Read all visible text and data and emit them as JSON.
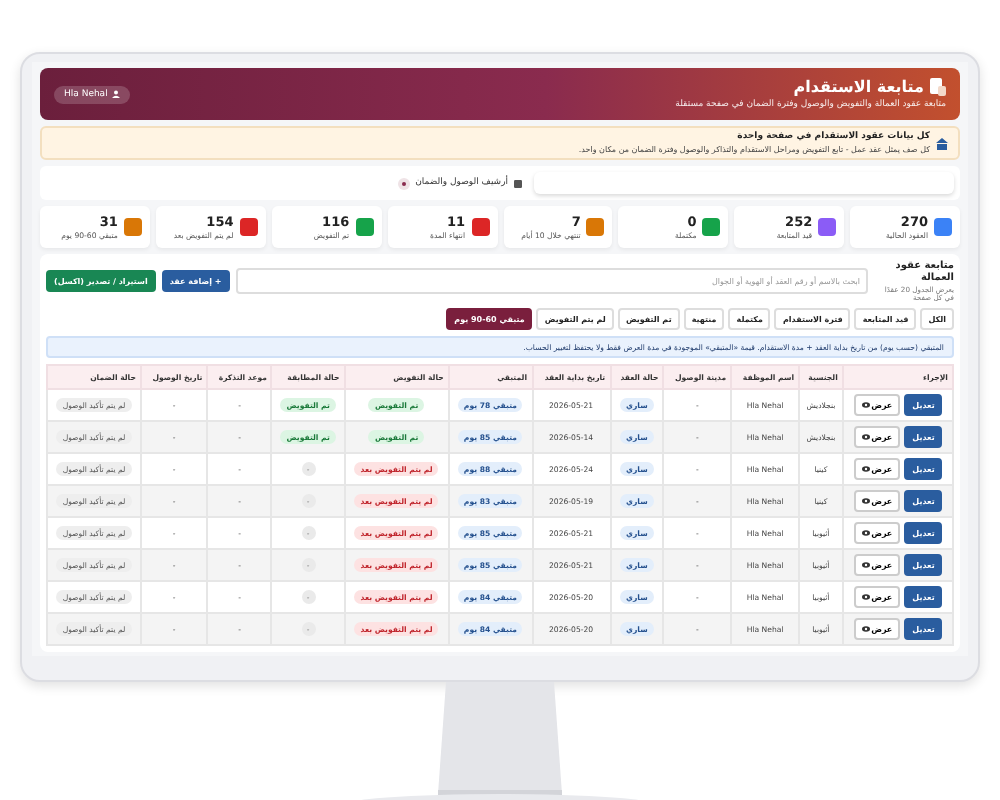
{
  "header": {
    "title": "متابعة الاستقدام",
    "subtitle": "متابعة عقود العمالة والتفويض والوصول وفترة الضمان في صفحة مستقلة",
    "user": "Hla Nehal"
  },
  "notice": {
    "title": "كل بيانات عقود الاستقدام في صفحة واحدة",
    "text": "كل صف يمثل عقد عمل - تابع التفويض ومراحل الاستقدام والتذاكر والوصول وفترة الضمان من مكان واحد."
  },
  "archive": {
    "label": "أرشيف الوصول والضمان"
  },
  "stats": [
    {
      "value": "270",
      "label": "العقود الحالية",
      "color": "#3b82f6"
    },
    {
      "value": "252",
      "label": "قيد المتابعة",
      "color": "#8b5cf6"
    },
    {
      "value": "0",
      "label": "مكتملة",
      "color": "#16a34a"
    },
    {
      "value": "7",
      "label": "تنتهي خلال 10 أيام",
      "color": "#d97706"
    },
    {
      "value": "11",
      "label": "انتهاء المدة",
      "color": "#dc2626"
    },
    {
      "value": "116",
      "label": "تم التفويض",
      "color": "#16a34a"
    },
    {
      "value": "154",
      "label": "لم يتم التفويض بعد",
      "color": "#dc2626"
    },
    {
      "value": "31",
      "label": "متبقي 60-90 يوم",
      "color": "#d97706"
    }
  ],
  "table_card": {
    "title": "متابعة عقود العمالة",
    "subtitle": "يعرض الجدول 20 عقدًا في كل صفحة",
    "search": {
      "placeholder": "ابحث بالاسم أو رقم العقد أو الهوية أو الجوال"
    },
    "buttons": [
      {
        "label": "+ إضافة عقد",
        "kind": "primary"
      },
      {
        "label": "استيراد / تصدير (اكسل)",
        "kind": "success"
      }
    ],
    "filters": [
      {
        "label": "الكل",
        "selected": false
      },
      {
        "label": "قيد المتابعة",
        "selected": false
      },
      {
        "label": "فترة الاستقدام",
        "selected": false
      },
      {
        "label": "مكتملة",
        "selected": false
      },
      {
        "label": "منتهية",
        "selected": false
      },
      {
        "label": "تم التفويض",
        "selected": false
      },
      {
        "label": "لم يتم التفويض",
        "selected": false
      },
      {
        "label": "متبقي 60-90 يوم",
        "selected": true
      }
    ],
    "note": "المتبقي (حسب يوم) من تاريخ بداية العقد + مدة الاستقدام. قيمة «المتبقي» الموجودة في مدة العرض فقط ولا يحتفظ لتغيير الحساب.",
    "columns": [
      "الإجراء",
      "الجنسية",
      "اسم الموظفة",
      "مدينة الوصول",
      "حالة العقد",
      "تاريخ بداية العقد",
      "المتبقي",
      "حالة التفويض",
      "حالة المطابقة",
      "موعد التذكرة",
      "تاريخ الوصول",
      "حالة الضمان"
    ],
    "rows": [
      {
        "view": "عرض",
        "edit": "تعديل",
        "nationality": "بنجلاديش",
        "name": "Hla Nehal",
        "city": "-",
        "contract": "ساري",
        "start": "2026-05-21",
        "remaining": "متبقي 78 يوم",
        "auth": {
          "label": "تم التفويض",
          "kind": "done"
        },
        "match": {
          "label": "تم التفويض",
          "kind": "done"
        },
        "ticket": "-",
        "arrival": "-",
        "guarantee": "لم يتم تأكيد الوصول"
      },
      {
        "view": "عرض",
        "edit": "تعديل",
        "nationality": "بنجلاديش",
        "name": "Hla Nehal",
        "city": "-",
        "contract": "ساري",
        "start": "2026-05-14",
        "remaining": "متبقي 85 يوم",
        "auth": {
          "label": "تم التفويض",
          "kind": "done"
        },
        "match": {
          "label": "تم التفويض",
          "kind": "done"
        },
        "ticket": "-",
        "arrival": "-",
        "guarantee": "لم يتم تأكيد الوصول"
      },
      {
        "view": "عرض",
        "edit": "تعديل",
        "nationality": "كينيا",
        "name": "Hla Nehal",
        "city": "-",
        "contract": "ساري",
        "start": "2026-05-24",
        "remaining": "متبقي 88 يوم",
        "auth": {
          "label": "لم يتم التفويض بعد",
          "kind": "pending"
        },
        "match": {
          "label": "-",
          "kind": "none"
        },
        "ticket": "-",
        "arrival": "-",
        "guarantee": "لم يتم تأكيد الوصول"
      },
      {
        "view": "عرض",
        "edit": "تعديل",
        "nationality": "كينيا",
        "name": "Hla Nehal",
        "city": "-",
        "contract": "ساري",
        "start": "2026-05-19",
        "remaining": "متبقي 83 يوم",
        "auth": {
          "label": "لم يتم التفويض بعد",
          "kind": "pending"
        },
        "match": {
          "label": "-",
          "kind": "none"
        },
        "ticket": "-",
        "arrival": "-",
        "guarantee": "لم يتم تأكيد الوصول"
      },
      {
        "view": "عرض",
        "edit": "تعديل",
        "nationality": "أثيوبيا",
        "name": "Hla Nehal",
        "city": "-",
        "contract": "ساري",
        "start": "2026-05-21",
        "remaining": "متبقي 85 يوم",
        "auth": {
          "label": "لم يتم التفويض بعد",
          "kind": "pending"
        },
        "match": {
          "label": "-",
          "kind": "none"
        },
        "ticket": "-",
        "arrival": "-",
        "guarantee": "لم يتم تأكيد الوصول"
      },
      {
        "view": "عرض",
        "edit": "تعديل",
        "nationality": "أثيوبيا",
        "name": "Hla Nehal",
        "city": "-",
        "contract": "ساري",
        "start": "2026-05-21",
        "remaining": "متبقي 85 يوم",
        "auth": {
          "label": "لم يتم التفويض بعد",
          "kind": "pending"
        },
        "match": {
          "label": "-",
          "kind": "none"
        },
        "ticket": "-",
        "arrival": "-",
        "guarantee": "لم يتم تأكيد الوصول"
      },
      {
        "view": "عرض",
        "edit": "تعديل",
        "nationality": "أثيوبيا",
        "name": "Hla Nehal",
        "city": "-",
        "contract": "ساري",
        "start": "2026-05-20",
        "remaining": "متبقي 84 يوم",
        "auth": {
          "label": "لم يتم التفويض بعد",
          "kind": "pending"
        },
        "match": {
          "label": "-",
          "kind": "none"
        },
        "ticket": "-",
        "arrival": "-",
        "guarantee": "لم يتم تأكيد الوصول"
      },
      {
        "view": "عرض",
        "edit": "تعديل",
        "nationality": "أثيوبيا",
        "name": "Hla Nehal",
        "city": "-",
        "contract": "ساري",
        "start": "2026-05-20",
        "remaining": "متبقي 84 يوم",
        "auth": {
          "label": "لم يتم التفويض بعد",
          "kind": "pending"
        },
        "match": {
          "label": "-",
          "kind": "none"
        },
        "ticket": "-",
        "arrival": "-",
        "guarantee": "لم يتم تأكيد الوصول"
      }
    ]
  }
}
